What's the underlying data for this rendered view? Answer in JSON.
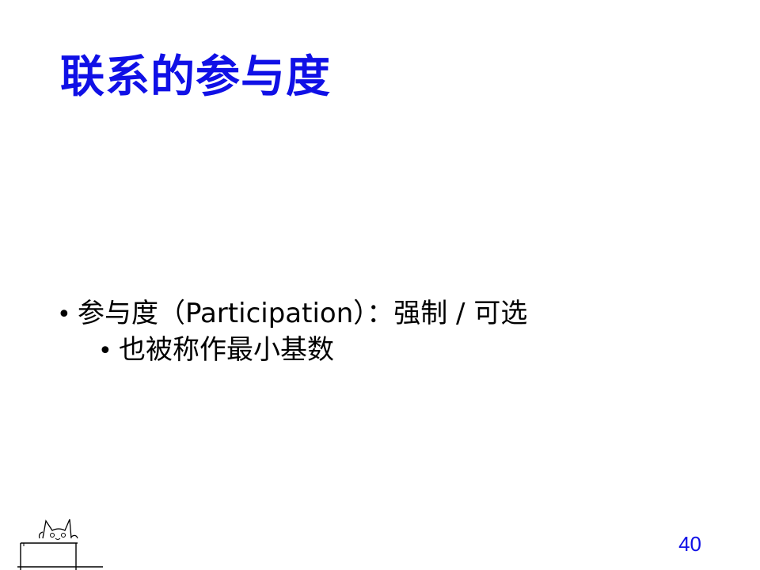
{
  "slide": {
    "title": "联系的参与度",
    "bullets": [
      "参与度（Participation）：强制 / 可选",
      "也被称作最小基数"
    ],
    "bullet_marker": "•",
    "page_number": "40",
    "mascot_icon": "cat-at-desk-icon"
  },
  "colors": {
    "title": "#1010e6",
    "page_number": "#1010e6",
    "body_text": "#000000"
  }
}
